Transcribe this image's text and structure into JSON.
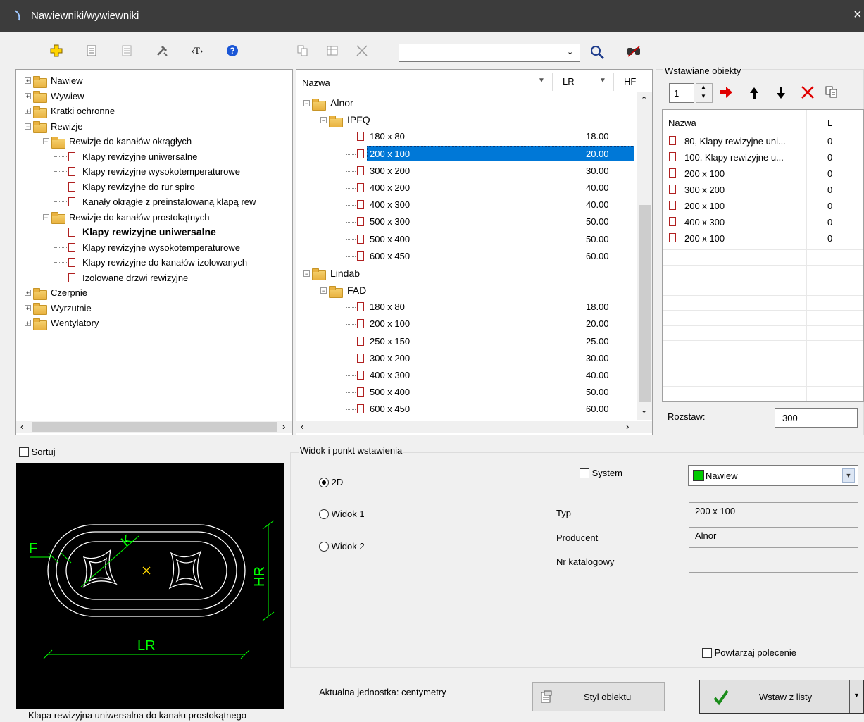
{
  "window": {
    "title": "Nawiewniki/wywiewniki",
    "close_symbol": "×"
  },
  "toolbar": {
    "text_tool": "‹T›",
    "help": "?",
    "search_value": ""
  },
  "tree": {
    "items": [
      {
        "label": "Nawiew",
        "level": 0,
        "type": "folder",
        "expander": "+"
      },
      {
        "label": "Wywiew",
        "level": 0,
        "type": "folder",
        "expander": "+"
      },
      {
        "label": "Kratki ochronne",
        "level": 0,
        "type": "folder",
        "expander": "+"
      },
      {
        "label": "Rewizje",
        "level": 0,
        "type": "folder",
        "expander": "−"
      },
      {
        "label": "Rewizje do kanałów okrągłych",
        "level": 1,
        "type": "folder",
        "expander": "−"
      },
      {
        "label": "Klapy rewizyjne uniwersalne",
        "level": 2,
        "type": "doc"
      },
      {
        "label": "Klapy rewizyjne wysokotemperaturowe",
        "level": 2,
        "type": "doc"
      },
      {
        "label": "Klapy rewizyjne do rur spiro",
        "level": 2,
        "type": "doc"
      },
      {
        "label": "Kanały okrągłe z preinstalowaną klapą rew",
        "level": 2,
        "type": "doc"
      },
      {
        "label": "Rewizje do kanałów prostokątnych",
        "level": 1,
        "type": "folder",
        "expander": "−"
      },
      {
        "label": "Klapy rewizyjne uniwersalne",
        "level": 2,
        "type": "doc",
        "bold": true
      },
      {
        "label": "Klapy rewizyjne wysokotemperaturowe",
        "level": 2,
        "type": "doc"
      },
      {
        "label": "Klapy rewizyjne do kanałów izolowanych",
        "level": 2,
        "type": "doc"
      },
      {
        "label": "Izolowane drzwi rewizyjne",
        "level": 2,
        "type": "doc"
      },
      {
        "label": "Czerpnie",
        "level": 0,
        "type": "folder",
        "expander": "+"
      },
      {
        "label": "Wyrzutnie",
        "level": 0,
        "type": "folder",
        "expander": "+"
      },
      {
        "label": "Wentylatory",
        "level": 0,
        "type": "folder",
        "expander": "+"
      }
    ]
  },
  "catalog": {
    "headers": {
      "name": "Nazwa",
      "lr": "LR",
      "hr": "HF"
    },
    "rows": [
      {
        "name": "Alnor",
        "level": 0,
        "type": "folder",
        "lr": ""
      },
      {
        "name": "IPFQ",
        "level": 1,
        "type": "folder",
        "lr": ""
      },
      {
        "name": "180 x 80",
        "level": 2,
        "type": "doc",
        "lr": "18.00"
      },
      {
        "name": "200 x 100",
        "level": 2,
        "type": "doc",
        "lr": "20.00",
        "selected": true
      },
      {
        "name": "300 x 200",
        "level": 2,
        "type": "doc",
        "lr": "30.00"
      },
      {
        "name": "400 x 200",
        "level": 2,
        "type": "doc",
        "lr": "40.00"
      },
      {
        "name": "400 x 300",
        "level": 2,
        "type": "doc",
        "lr": "40.00"
      },
      {
        "name": "500 x 300",
        "level": 2,
        "type": "doc",
        "lr": "50.00"
      },
      {
        "name": "500 x 400",
        "level": 2,
        "type": "doc",
        "lr": "50.00"
      },
      {
        "name": "600 x 450",
        "level": 2,
        "type": "doc",
        "lr": "60.00"
      },
      {
        "name": "Lindab",
        "level": 0,
        "type": "folder",
        "lr": ""
      },
      {
        "name": "FAD",
        "level": 1,
        "type": "folder",
        "lr": ""
      },
      {
        "name": "180 x 80",
        "level": 2,
        "type": "doc",
        "lr": "18.00"
      },
      {
        "name": "200 x 100",
        "level": 2,
        "type": "doc",
        "lr": "20.00"
      },
      {
        "name": "250 x 150",
        "level": 2,
        "type": "doc",
        "lr": "25.00"
      },
      {
        "name": "300 x 200",
        "level": 2,
        "type": "doc",
        "lr": "30.00"
      },
      {
        "name": "400 x 300",
        "level": 2,
        "type": "doc",
        "lr": "40.00"
      },
      {
        "name": "500 x 400",
        "level": 2,
        "type": "doc",
        "lr": "50.00"
      },
      {
        "name": "600 x 450",
        "level": 2,
        "type": "doc",
        "lr": "60.00"
      }
    ]
  },
  "inserted": {
    "group_label": "Wstawiane obiekty",
    "quantity": "1",
    "headers": {
      "name": "Nazwa",
      "l": "L"
    },
    "rows": [
      {
        "name": "80, Klapy rewizyjne uni...",
        "l": "0"
      },
      {
        "name": "100, Klapy rewizyjne u...",
        "l": "0"
      },
      {
        "name": "200 x 100",
        "l": "0"
      },
      {
        "name": "300 x 200",
        "l": "0"
      },
      {
        "name": "200 x 100",
        "l": "0"
      },
      {
        "name": "400 x 300",
        "l": "0"
      },
      {
        "name": "200 x 100",
        "l": "0"
      }
    ],
    "spacing_label": "Rozstaw:",
    "spacing_value": "300"
  },
  "sort_label": "Sortuj",
  "preview": {
    "caption": "Klapa rewizyjna uniwersalna do kanału prostokątnego",
    "labels": {
      "f": "F",
      "k": "K",
      "hr": "HR",
      "lr": "LR"
    }
  },
  "view": {
    "group_label": "Widok i punkt wstawienia",
    "options": [
      "2D",
      "Widok 1",
      "Widok 2"
    ],
    "selected": "2D",
    "system_label": "System",
    "system_value": "Nawiew",
    "system_color": "#00cc00",
    "typ_label": "Typ",
    "typ_value": "200 x 100",
    "producent_label": "Producent",
    "producent_value": "Alnor",
    "nr_label": "Nr katalogowy",
    "nr_value": "",
    "repeat_label": "Powtarzaj polecenie"
  },
  "footer": {
    "unit_text": "Aktualna jednostka: centymetry",
    "style_button": "Styl obiektu",
    "insert_button": "Wstaw z listy"
  }
}
